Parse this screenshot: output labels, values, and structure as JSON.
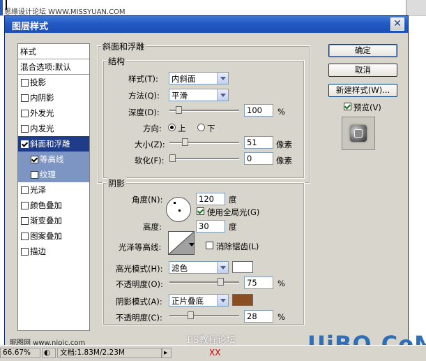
{
  "site_title": "思缘设计论坛  WWW.MISSYUAN.COM",
  "dialog": {
    "title": "图层样式",
    "close_glyph": "✕"
  },
  "style_list": {
    "header": "样式",
    "blend_options": "混合选项:默认",
    "items": [
      {
        "label": "投影",
        "checked": false
      },
      {
        "label": "内阴影",
        "checked": false
      },
      {
        "label": "外发光",
        "checked": false
      },
      {
        "label": "内发光",
        "checked": false
      },
      {
        "label": "斜面和浮雕",
        "checked": true,
        "selected": true
      },
      {
        "label": "等高线",
        "checked": true,
        "sub": true
      },
      {
        "label": "纹理",
        "checked": false,
        "sub": true
      },
      {
        "label": "光泽",
        "checked": false
      },
      {
        "label": "颜色叠加",
        "checked": false
      },
      {
        "label": "渐变叠加",
        "checked": false
      },
      {
        "label": "图案叠加",
        "checked": false
      },
      {
        "label": "描边",
        "checked": false
      }
    ]
  },
  "bevel": {
    "group_title": "斜面和浮雕",
    "structure_title": "结构",
    "style_label": "样式(T):",
    "style_value": "内斜面",
    "method_label": "方法(Q):",
    "method_value": "平滑",
    "depth_label": "深度(D):",
    "depth_value": "100",
    "depth_unit": "%",
    "depth_level": 0.1,
    "direction_label": "方向:",
    "direction_up": "上",
    "direction_down": "下",
    "direction_selected": "上",
    "size_label": "大小(Z):",
    "size_value": "51",
    "size_unit": "像素",
    "size_level": 0.2,
    "soften_label": "软化(F):",
    "soften_value": "0",
    "soften_unit": "像素",
    "soften_level": 0.0
  },
  "shading": {
    "title": "阴影",
    "angle_label": "角度(N):",
    "angle_value": "120",
    "angle_unit": "度",
    "global_light_label": "使用全局光(G)",
    "global_light_checked": true,
    "altitude_label": "高度:",
    "altitude_value": "30",
    "altitude_unit": "度",
    "gloss_label": "光泽等高线:",
    "antialias_label": "消除锯齿(L)",
    "antialias_checked": false,
    "highlight_mode_label": "高光模式(H):",
    "highlight_mode_value": "滤色",
    "highlight_color": "#ffffff",
    "highlight_opacity_label": "不透明度(O):",
    "highlight_opacity_value": "75",
    "highlight_opacity_unit": "%",
    "highlight_opacity_level": 0.75,
    "shadow_mode_label": "阴影模式(A):",
    "shadow_mode_value": "正片叠底",
    "shadow_color": "#8b4e22",
    "shadow_opacity_label": "不透明度(C):",
    "shadow_opacity_value": "28",
    "shadow_opacity_unit": "%",
    "shadow_opacity_level": 0.28
  },
  "buttons": {
    "ok": "确定",
    "cancel": "取消",
    "new_style": "新建样式(W)...",
    "preview_label": "预览(V)",
    "preview_checked": true
  },
  "status_bar": {
    "zoom": "66.67%",
    "doc_info": "文档:1.83M/2.23M"
  },
  "watermarks": {
    "left": "昵图网 www.nipic.com",
    "center": "PS教程论坛",
    "bottom": "XX",
    "logo": "UiBQ.CoM"
  },
  "colors": {
    "titlebar": "#2359c4",
    "selection": "#1e3c8a",
    "sub_selection": "#7d95c3",
    "dialog_bg": "#d8d5cc"
  }
}
